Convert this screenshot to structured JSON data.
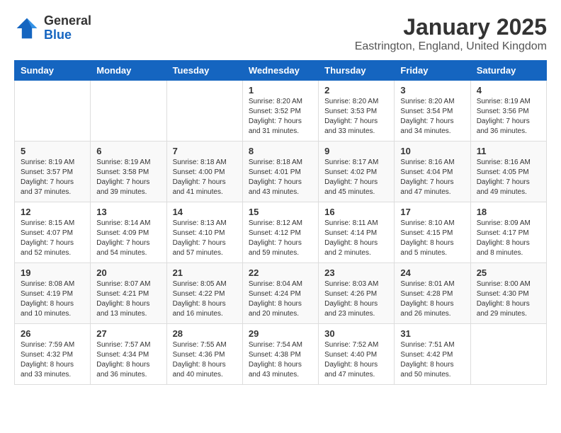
{
  "header": {
    "logo_general": "General",
    "logo_blue": "Blue",
    "title": "January 2025",
    "subtitle": "Eastrington, England, United Kingdom"
  },
  "calendar": {
    "weekdays": [
      "Sunday",
      "Monday",
      "Tuesday",
      "Wednesday",
      "Thursday",
      "Friday",
      "Saturday"
    ],
    "weeks": [
      [
        {
          "day": "",
          "info": ""
        },
        {
          "day": "",
          "info": ""
        },
        {
          "day": "",
          "info": ""
        },
        {
          "day": "1",
          "info": "Sunrise: 8:20 AM\nSunset: 3:52 PM\nDaylight: 7 hours\nand 31 minutes."
        },
        {
          "day": "2",
          "info": "Sunrise: 8:20 AM\nSunset: 3:53 PM\nDaylight: 7 hours\nand 33 minutes."
        },
        {
          "day": "3",
          "info": "Sunrise: 8:20 AM\nSunset: 3:54 PM\nDaylight: 7 hours\nand 34 minutes."
        },
        {
          "day": "4",
          "info": "Sunrise: 8:19 AM\nSunset: 3:56 PM\nDaylight: 7 hours\nand 36 minutes."
        }
      ],
      [
        {
          "day": "5",
          "info": "Sunrise: 8:19 AM\nSunset: 3:57 PM\nDaylight: 7 hours\nand 37 minutes."
        },
        {
          "day": "6",
          "info": "Sunrise: 8:19 AM\nSunset: 3:58 PM\nDaylight: 7 hours\nand 39 minutes."
        },
        {
          "day": "7",
          "info": "Sunrise: 8:18 AM\nSunset: 4:00 PM\nDaylight: 7 hours\nand 41 minutes."
        },
        {
          "day": "8",
          "info": "Sunrise: 8:18 AM\nSunset: 4:01 PM\nDaylight: 7 hours\nand 43 minutes."
        },
        {
          "day": "9",
          "info": "Sunrise: 8:17 AM\nSunset: 4:02 PM\nDaylight: 7 hours\nand 45 minutes."
        },
        {
          "day": "10",
          "info": "Sunrise: 8:16 AM\nSunset: 4:04 PM\nDaylight: 7 hours\nand 47 minutes."
        },
        {
          "day": "11",
          "info": "Sunrise: 8:16 AM\nSunset: 4:05 PM\nDaylight: 7 hours\nand 49 minutes."
        }
      ],
      [
        {
          "day": "12",
          "info": "Sunrise: 8:15 AM\nSunset: 4:07 PM\nDaylight: 7 hours\nand 52 minutes."
        },
        {
          "day": "13",
          "info": "Sunrise: 8:14 AM\nSunset: 4:09 PM\nDaylight: 7 hours\nand 54 minutes."
        },
        {
          "day": "14",
          "info": "Sunrise: 8:13 AM\nSunset: 4:10 PM\nDaylight: 7 hours\nand 57 minutes."
        },
        {
          "day": "15",
          "info": "Sunrise: 8:12 AM\nSunset: 4:12 PM\nDaylight: 7 hours\nand 59 minutes."
        },
        {
          "day": "16",
          "info": "Sunrise: 8:11 AM\nSunset: 4:14 PM\nDaylight: 8 hours\nand 2 minutes."
        },
        {
          "day": "17",
          "info": "Sunrise: 8:10 AM\nSunset: 4:15 PM\nDaylight: 8 hours\nand 5 minutes."
        },
        {
          "day": "18",
          "info": "Sunrise: 8:09 AM\nSunset: 4:17 PM\nDaylight: 8 hours\nand 8 minutes."
        }
      ],
      [
        {
          "day": "19",
          "info": "Sunrise: 8:08 AM\nSunset: 4:19 PM\nDaylight: 8 hours\nand 10 minutes."
        },
        {
          "day": "20",
          "info": "Sunrise: 8:07 AM\nSunset: 4:21 PM\nDaylight: 8 hours\nand 13 minutes."
        },
        {
          "day": "21",
          "info": "Sunrise: 8:05 AM\nSunset: 4:22 PM\nDaylight: 8 hours\nand 16 minutes."
        },
        {
          "day": "22",
          "info": "Sunrise: 8:04 AM\nSunset: 4:24 PM\nDaylight: 8 hours\nand 20 minutes."
        },
        {
          "day": "23",
          "info": "Sunrise: 8:03 AM\nSunset: 4:26 PM\nDaylight: 8 hours\nand 23 minutes."
        },
        {
          "day": "24",
          "info": "Sunrise: 8:01 AM\nSunset: 4:28 PM\nDaylight: 8 hours\nand 26 minutes."
        },
        {
          "day": "25",
          "info": "Sunrise: 8:00 AM\nSunset: 4:30 PM\nDaylight: 8 hours\nand 29 minutes."
        }
      ],
      [
        {
          "day": "26",
          "info": "Sunrise: 7:59 AM\nSunset: 4:32 PM\nDaylight: 8 hours\nand 33 minutes."
        },
        {
          "day": "27",
          "info": "Sunrise: 7:57 AM\nSunset: 4:34 PM\nDaylight: 8 hours\nand 36 minutes."
        },
        {
          "day": "28",
          "info": "Sunrise: 7:55 AM\nSunset: 4:36 PM\nDaylight: 8 hours\nand 40 minutes."
        },
        {
          "day": "29",
          "info": "Sunrise: 7:54 AM\nSunset: 4:38 PM\nDaylight: 8 hours\nand 43 minutes."
        },
        {
          "day": "30",
          "info": "Sunrise: 7:52 AM\nSunset: 4:40 PM\nDaylight: 8 hours\nand 47 minutes."
        },
        {
          "day": "31",
          "info": "Sunrise: 7:51 AM\nSunset: 4:42 PM\nDaylight: 8 hours\nand 50 minutes."
        },
        {
          "day": "",
          "info": ""
        }
      ]
    ]
  }
}
